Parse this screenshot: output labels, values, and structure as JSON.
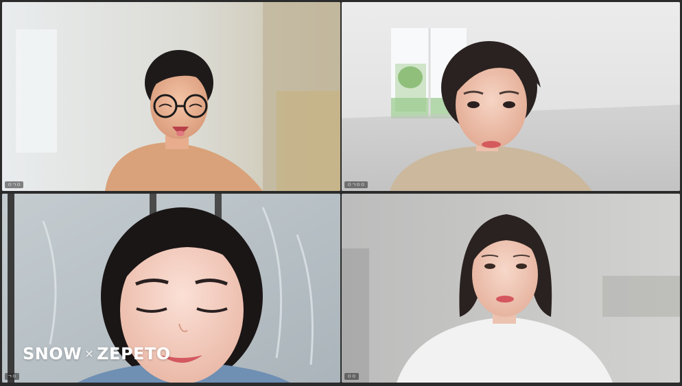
{
  "app": {
    "accent_color": "#3cc98f"
  },
  "tiles": [
    {
      "name": "avatar-tile-1",
      "label": "ㅇㄱㅇ",
      "active": false
    },
    {
      "name": "avatar-tile-2",
      "label": "ㅇㄱㅇㅇ",
      "active": false
    },
    {
      "name": "avatar-tile-3",
      "label": "ㄱㅇ",
      "active": true
    },
    {
      "name": "avatar-tile-4",
      "label": "ㅇㅇ",
      "active": false
    }
  ],
  "brand": {
    "left": "SNOW",
    "separator": "×",
    "right": "ZEPETO"
  }
}
